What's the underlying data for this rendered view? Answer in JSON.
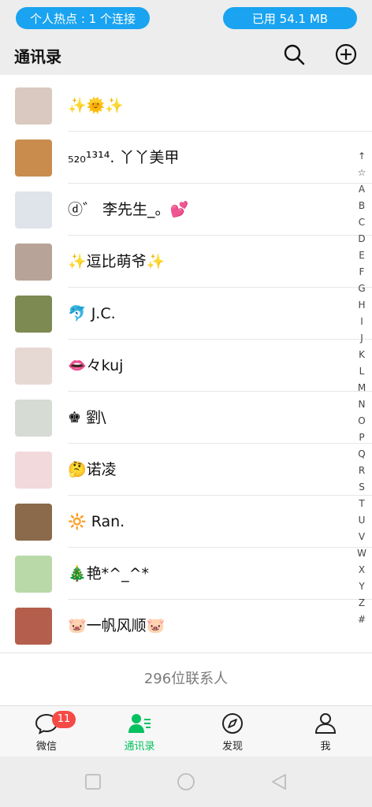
{
  "status_bar": {
    "hotspot_label": "个人热点 : 1 个连接",
    "data_used_label": "已用 54.1 MB"
  },
  "header": {
    "title": "通讯录",
    "icons": [
      "search-icon",
      "add-icon"
    ]
  },
  "contacts": [
    {
      "name": "✨🌞✨",
      "avatar_color": "#d9c9c0"
    },
    {
      "name": "₅₂₀¹³¹⁴.  丫丫美甲",
      "avatar_color": "#c98c4d"
    },
    {
      "name": "ⓓ゛ 李先生_。💕",
      "avatar_color": "#dfe3ea"
    },
    {
      "name": "✨逗比萌爷✨",
      "avatar_color": "#b7a398"
    },
    {
      "name": "🐬 J.C.",
      "avatar_color": "#7d8a52"
    },
    {
      "name": "👄々kuj",
      "avatar_color": "#e6d8d2"
    },
    {
      "name": "♚ 劉\\",
      "avatar_color": "#d6dbd3"
    },
    {
      "name": "🤔诺凌",
      "avatar_color": "#f2d9dc"
    },
    {
      "name": "🔆 Ran.",
      "avatar_color": "#8a6a4a"
    },
    {
      "name": "🎄艳*^_^*",
      "avatar_color": "#b9d9a8"
    },
    {
      "name": "🐷一帆风顺🐷",
      "avatar_color": "#b45f4d"
    }
  ],
  "index_bar": [
    "↑",
    "☆",
    "A",
    "B",
    "C",
    "D",
    "E",
    "F",
    "G",
    "H",
    "I",
    "J",
    "K",
    "L",
    "M",
    "N",
    "O",
    "P",
    "Q",
    "R",
    "S",
    "T",
    "U",
    "V",
    "W",
    "X",
    "Y",
    "Z",
    "#"
  ],
  "contact_count": "296位联系人",
  "tabs": [
    {
      "label": "微信",
      "icon": "chat-icon",
      "badge": "11",
      "active": false
    },
    {
      "label": "通讯录",
      "icon": "contacts-icon",
      "active": true
    },
    {
      "label": "发现",
      "icon": "compass-icon",
      "active": false
    },
    {
      "label": "我",
      "icon": "person-icon",
      "active": false
    }
  ],
  "colors": {
    "accent": "#07c160",
    "pill": "#1aa3f0",
    "badge": "#f54a45"
  }
}
